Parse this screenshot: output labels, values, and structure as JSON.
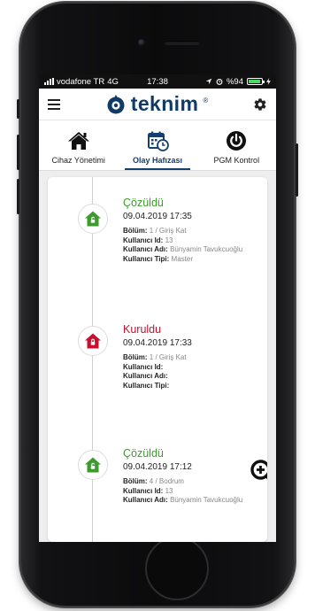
{
  "status_bar": {
    "carrier": "vodafone TR",
    "network": "4G",
    "time": "17:38",
    "battery": "%94"
  },
  "header": {
    "brand": "teknim",
    "reg_mark": "®"
  },
  "tabs": [
    {
      "label": "Cihaz Yönetimi",
      "icon": "home-icon"
    },
    {
      "label": "Olay Hafızası",
      "icon": "calendar-clock-icon",
      "active": true
    },
    {
      "label": "PGM Kontrol",
      "icon": "power-icon"
    }
  ],
  "field_labels": {
    "section": "Bölüm:",
    "user_id": "Kullanıcı Id:",
    "user_name": "Kullanıcı Adı:",
    "user_type": "Kullanıcı Tipi:"
  },
  "events": [
    {
      "status": "Çözüldü",
      "status_color": "#3d9b2e",
      "icon": "unlocked-house-icon",
      "date": "09.04.2019 17:35",
      "section": "1 / Giriş Kat",
      "user_id": "13",
      "user_name": "Bünyamin Tavukcuoğlu",
      "user_type": "Master"
    },
    {
      "status": "Kuruldu",
      "status_color": "#c8102e",
      "icon": "locked-house-icon",
      "date": "09.04.2019 17:33",
      "section": "1 / Giriş Kat",
      "user_id": "",
      "user_name": "",
      "user_type": ""
    },
    {
      "status": "Çözüldü",
      "status_color": "#3d9b2e",
      "icon": "unlocked-house-icon",
      "date": "09.04.2019 17:12",
      "section": "4 / Bodrum",
      "user_id": "13",
      "user_name": "Bünyamin Tavukcuoğlu",
      "user_type": ""
    }
  ],
  "colors": {
    "brand_navy": "#0f3b66",
    "active_tab": "#15406e",
    "solved_green": "#3d9b2e",
    "armed_red": "#c8102e"
  },
  "zoom_icon": "zoom-in-icon"
}
